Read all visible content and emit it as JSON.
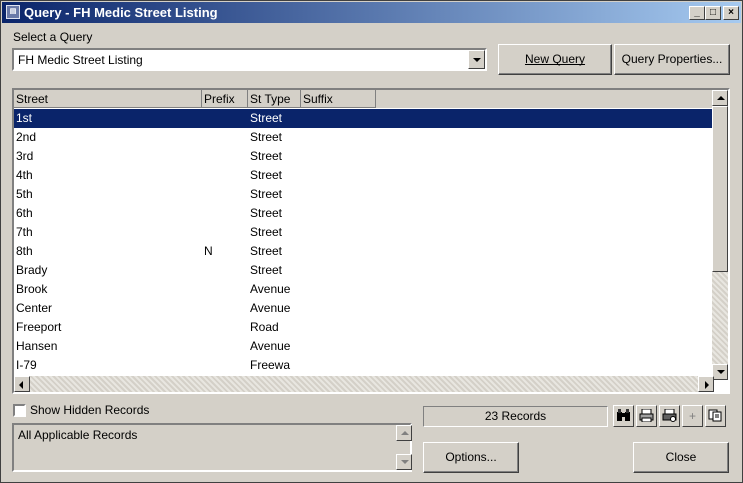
{
  "window": {
    "title": "Query - FH Medic Street Listing",
    "app_icon": "app-icon"
  },
  "select_query": {
    "label": "Select a Query",
    "value": "FH Medic Street Listing"
  },
  "buttons": {
    "new_query": "New Query",
    "query_properties": "Query Properties...",
    "options": "Options...",
    "close": "Close"
  },
  "grid": {
    "columns": [
      "Street",
      "Prefix",
      "St Type",
      "Suffix"
    ],
    "rows": [
      {
        "street": "1st",
        "prefix": "",
        "st_type": "Street",
        "suffix": ""
      },
      {
        "street": "2nd",
        "prefix": "",
        "st_type": "Street",
        "suffix": ""
      },
      {
        "street": "3rd",
        "prefix": "",
        "st_type": "Street",
        "suffix": ""
      },
      {
        "street": "4th",
        "prefix": "",
        "st_type": "Street",
        "suffix": ""
      },
      {
        "street": "5th",
        "prefix": "",
        "st_type": "Street",
        "suffix": ""
      },
      {
        "street": "6th",
        "prefix": "",
        "st_type": "Street",
        "suffix": ""
      },
      {
        "street": "7th",
        "prefix": "",
        "st_type": "Street",
        "suffix": ""
      },
      {
        "street": "8th",
        "prefix": "N",
        "st_type": "Street",
        "suffix": ""
      },
      {
        "street": "Brady",
        "prefix": "",
        "st_type": "Street",
        "suffix": ""
      },
      {
        "street": "Brook",
        "prefix": "",
        "st_type": "Avenue",
        "suffix": ""
      },
      {
        "street": "Center",
        "prefix": "",
        "st_type": "Avenue",
        "suffix": ""
      },
      {
        "street": "Freeport",
        "prefix": "",
        "st_type": "Road",
        "suffix": ""
      },
      {
        "street": "Hansen",
        "prefix": "",
        "st_type": "Avenue",
        "suffix": ""
      },
      {
        "street": "I-79",
        "prefix": "",
        "st_type": "Freewa",
        "suffix": ""
      }
    ]
  },
  "show_hidden": {
    "label": "Show Hidden Records",
    "checked": false
  },
  "memo": {
    "text": "All Applicable Records"
  },
  "record_count": "23 Records",
  "toolbar_icons": [
    "binoculars-icon",
    "print-icon",
    "print-setup-icon",
    "add-icon",
    "copy-icon"
  ],
  "colors": {
    "selection": "#0a246a",
    "title_start": "#0a246a",
    "title_end": "#a6caf0"
  }
}
